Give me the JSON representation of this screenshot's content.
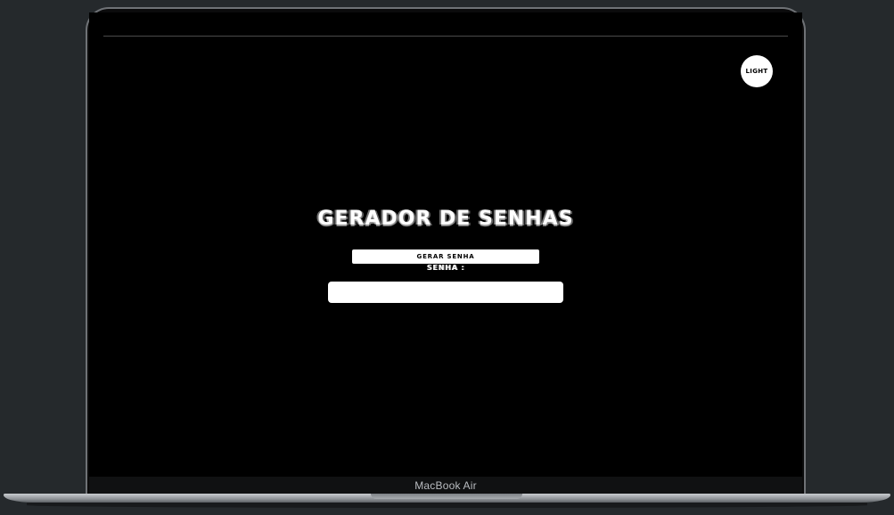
{
  "device": {
    "model_label": "MacBook Air"
  },
  "app": {
    "theme_toggle_label": "LIGHT",
    "title": "GERADOR DE SENHAS",
    "generate_button_label": "GERAR SENHA",
    "password_label": "SENHA :",
    "password_value": ""
  },
  "colors": {
    "page_background": "#000000",
    "text": "#ffffff",
    "button_background": "#ffffff",
    "button_text": "#000000",
    "desk_background": "#25292c"
  }
}
